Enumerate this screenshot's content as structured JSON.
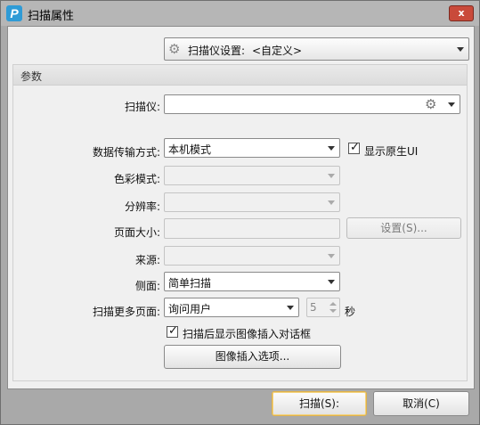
{
  "window": {
    "title": "扫描属性",
    "app_icon_letter": "P",
    "close_symbol": "x"
  },
  "scanner_settings": {
    "label": "扫描仪设置:",
    "value": "<自定义>"
  },
  "params_group": {
    "title": "参数"
  },
  "scanner": {
    "label": "扫描仪:",
    "value": ""
  },
  "transfer_mode": {
    "label": "数据传输方式:",
    "value": "本机模式"
  },
  "show_native_ui": {
    "label": "显示原生UI",
    "checked": true
  },
  "color_mode": {
    "label": "色彩模式:",
    "value": ""
  },
  "resolution": {
    "label": "分辨率:",
    "value": ""
  },
  "page_size": {
    "label": "页面大小:",
    "value": "",
    "settings_button": "设置(S)..."
  },
  "source": {
    "label": "来源:",
    "value": ""
  },
  "sides": {
    "label": "侧面:",
    "value": "简单扫描"
  },
  "scan_more": {
    "label": "扫描更多页面:",
    "value": "询问用户",
    "count": "5",
    "unit": "秒"
  },
  "show_insert_dialog": {
    "label": "扫描后显示图像插入对话框",
    "checked": true
  },
  "insert_options_button": "图像插入选项...",
  "footer": {
    "scan_button": "扫描(S):",
    "cancel_button": "取消(C)"
  }
}
